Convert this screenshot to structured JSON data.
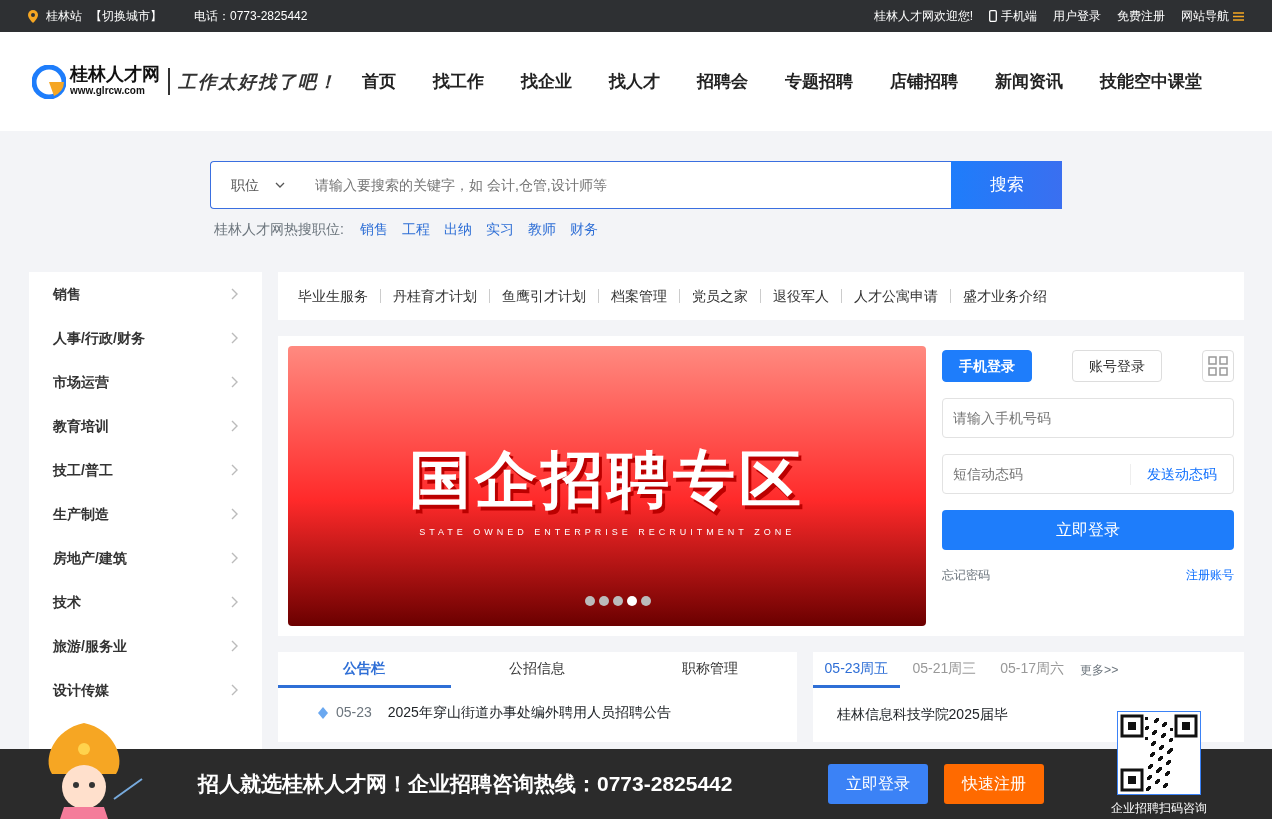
{
  "top_bar": {
    "location": "桂林站",
    "switch_city": "【切换城市】",
    "phone": "电话：0773-2825442",
    "welcome": "桂林人才网欢迎您!",
    "links": [
      {
        "label": "手机端",
        "kind": "mobile"
      },
      {
        "label": "用户登录",
        "kind": "plain"
      },
      {
        "label": "免费注册",
        "kind": "plain"
      },
      {
        "label": "网站导航",
        "kind": "menu"
      }
    ]
  },
  "header": {
    "logo_name": "桂林人才网",
    "logo_url": "www.glrcw.com",
    "slogan": "工作太好找了吧！",
    "nav": [
      "首页",
      "找工作",
      "找企业",
      "找人才",
      "招聘会",
      "专题招聘",
      "店铺招聘",
      "新闻资讯",
      "技能空中课堂"
    ]
  },
  "search": {
    "category": "职位",
    "placeholder": "请输入要搜索的关键字，如 会计,仓管,设计师等",
    "button": "搜索",
    "hot_label": "桂林人才网热搜职位:",
    "hot": [
      "销售",
      "工程",
      "出纳",
      "实习",
      "教师",
      "财务"
    ]
  },
  "sidebar": {
    "items": [
      "销售",
      "人事/行政/财务",
      "市场运营",
      "教育培训",
      "技工/普工",
      "生产制造",
      "房地产/建筑",
      "技术",
      "旅游/服务业",
      "设计传媒"
    ]
  },
  "services": [
    "毕业生服务",
    "丹桂育才计划",
    "鱼鹰引才计划",
    "档案管理",
    "党员之家",
    "退役军人",
    "人才公寓申请",
    "盛才业务介绍"
  ],
  "banner": {
    "title": "国企招聘专区",
    "subtitle": "STATE OWNED ENTERPRISE RECRUITMENT ZONE",
    "dots": [
      {
        "selected": false
      },
      {
        "selected": false
      },
      {
        "selected": false
      },
      {
        "selected": true
      },
      {
        "selected": false
      }
    ]
  },
  "login": {
    "tabs": [
      {
        "label": "手机登录",
        "selected": true
      },
      {
        "label": "账号登录",
        "selected": false
      }
    ],
    "phone_placeholder": "请输入手机号码",
    "code_placeholder": "短信动态码",
    "send_code": "发送动态码",
    "submit": "立即登录",
    "forgot": "忘记密码",
    "register": "注册账号"
  },
  "notices": {
    "tabs": [
      {
        "label": "公告栏",
        "selected": true
      },
      {
        "label": "公招信息",
        "selected": false
      },
      {
        "label": "职称管理",
        "selected": false
      }
    ],
    "items": [
      {
        "date": "05-23",
        "title": "2025年穿山街道办事处编外聘用人员招聘公告"
      }
    ]
  },
  "job_fairs": {
    "tabs": [
      {
        "label": "05-23周五",
        "selected": true
      },
      {
        "label": "05-21周三",
        "selected": false
      },
      {
        "label": "05-17周六",
        "selected": false
      }
    ],
    "more": "更多>>",
    "items": [
      {
        "title": "桂林信息科技学院2025届毕"
      }
    ]
  },
  "bottom_bar": {
    "slogan": "招人就选桂林人才网！企业招聘咨询热线：0773-2825442",
    "login": "立即登录",
    "register": "快速注册",
    "qr_caption": "企业招聘扫码咨询"
  }
}
